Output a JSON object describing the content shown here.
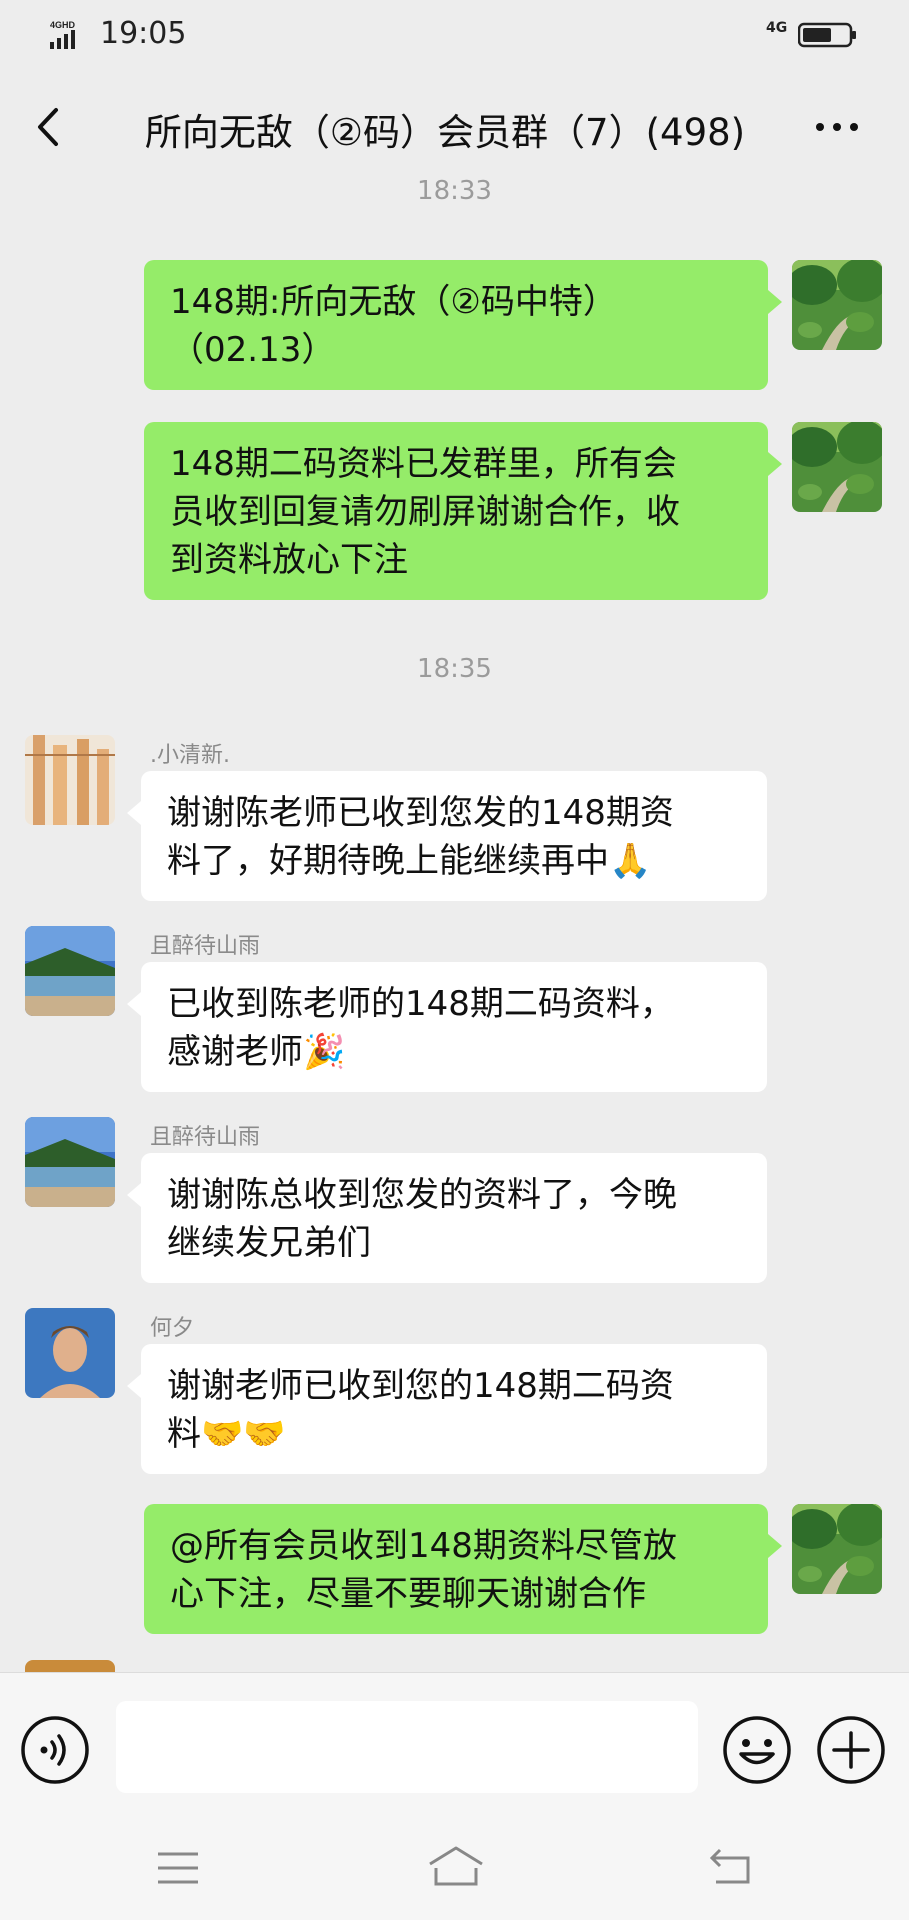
{
  "status_bar": {
    "time": "19:05",
    "network_left": "4GHD",
    "network_right": "4G"
  },
  "header": {
    "title": "所向无敌（②码）会员群（7）(498)"
  },
  "timestamps": [
    "18:33",
    "18:35"
  ],
  "messages": [
    {
      "direction": "out",
      "lines": [
        "148期:所向无敌（②码中特）",
        "（02.13）"
      ]
    },
    {
      "direction": "out",
      "lines": [
        "148期二码资料已发群里，所有会",
        "员收到回复请勿刷屏谢谢合作，收",
        "到资料放心下注"
      ]
    },
    {
      "direction": "in",
      "sender": ".小清新.",
      "lines": [
        "谢谢陈老师已收到您发的148期资",
        "料了，好期待晚上能继续再中🙏"
      ]
    },
    {
      "direction": "in",
      "sender": "且醉待山雨",
      "lines": [
        "已收到陈老师的148期二码资料，",
        "感谢老师🎉"
      ]
    },
    {
      "direction": "in",
      "sender": "且醉待山雨",
      "lines": [
        "谢谢陈总收到您发的资料了，今晚",
        "继续发兄弟们"
      ]
    },
    {
      "direction": "in",
      "sender": "何夕",
      "lines": [
        "谢谢老师已收到您的148期二码资",
        "料🤝🤝"
      ]
    },
    {
      "direction": "out",
      "lines": [
        "@所有会员收到148期资料尽管放",
        "心下注，尽量不要聊天谢谢合作"
      ]
    }
  ],
  "input": {
    "value": ""
  },
  "icons": {
    "back": "chevron-left-icon",
    "more": "more-dots-icon",
    "voice": "voice-icon",
    "emoji": "emoji-icon",
    "plus": "plus-icon",
    "sys_menu": "menu-icon",
    "sys_home": "home-icon",
    "sys_back": "back-icon"
  },
  "colors": {
    "outgoing_bubble": "#95ec69",
    "incoming_bubble": "#ffffff",
    "background": "#ededed"
  }
}
